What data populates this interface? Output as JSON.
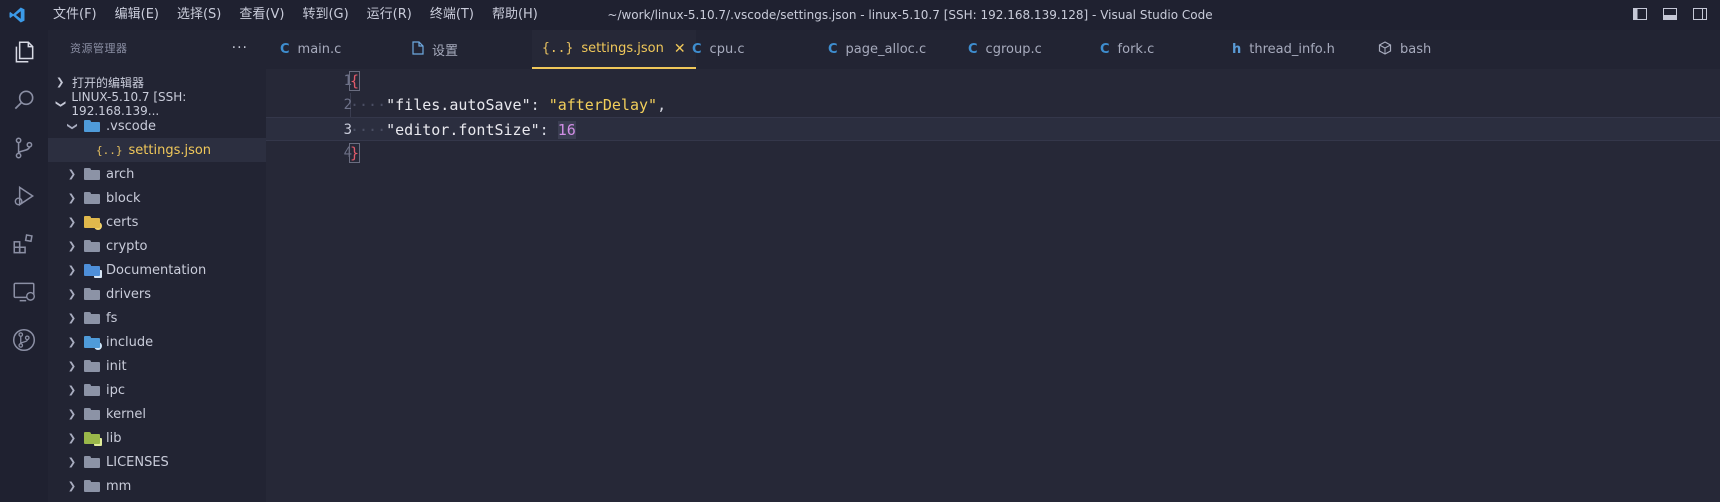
{
  "titlebar": {
    "menu": [
      "文件(F)",
      "编辑(E)",
      "选择(S)",
      "查看(V)",
      "转到(G)",
      "运行(R)",
      "终端(T)",
      "帮助(H)"
    ],
    "window_title": "~/work/linux-5.10.7/.vscode/settings.json - linux-5.10.7 [SSH: 192.168.139.128] - Visual Studio Code"
  },
  "activitybar": {
    "icons": [
      "explorer-icon",
      "search-icon",
      "source-control-icon",
      "run-debug-icon",
      "extensions-icon",
      "remote-explorer-icon",
      "git-graph-icon"
    ]
  },
  "sidebar": {
    "title": "资源管理器",
    "more": "···",
    "open_editors": "打开的编辑器",
    "workspace": "LINUX-5.10.7 [SSH: 192.168.139...",
    "vscode_folder": ".vscode",
    "settings_file": "settings.json",
    "folders": [
      "arch",
      "block",
      "certs",
      "crypto",
      "Documentation",
      "drivers",
      "fs",
      "include",
      "init",
      "ipc",
      "kernel",
      "lib",
      "LICENSES",
      "mm"
    ]
  },
  "tabs": [
    {
      "label": "main.c",
      "icon": "C"
    },
    {
      "label": "设置",
      "icon": "settings-file-icon"
    },
    {
      "label": "settings.json",
      "icon": "{..}",
      "active": true
    },
    {
      "label": "cpu.c",
      "icon": "C"
    },
    {
      "label": "page_alloc.c",
      "icon": "C"
    },
    {
      "label": "cgroup.c",
      "icon": "C"
    },
    {
      "label": "fork.c",
      "icon": "C"
    },
    {
      "label": "thread_info.h",
      "icon": "h"
    },
    {
      "label": "bash",
      "icon": "terminal-icon"
    }
  ],
  "editor": {
    "line_numbers": [
      "1",
      "2",
      "3",
      "4"
    ],
    "current_line": 3,
    "lines": {
      "l1_open": "{",
      "l2_key": "\"files.autoSave\"",
      "l2_colon": ": ",
      "l2_val": "\"afterDelay\"",
      "l2_comma": ",",
      "l3_key": "\"editor.fontSize\"",
      "l3_colon": ": ",
      "l3_val": "16",
      "l4_close": "}"
    }
  },
  "colors": {
    "accent": "#f0c85a",
    "background": "#262837",
    "sidebar": "#222433",
    "activitybar": "#1f2130"
  }
}
